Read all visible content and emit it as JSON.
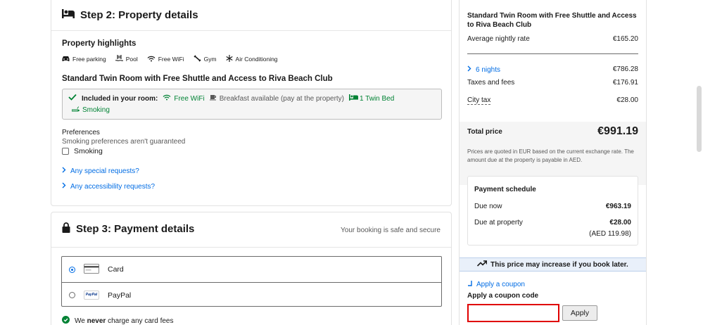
{
  "step2": {
    "title": "Step 2: Property details",
    "highlights_title": "Property highlights",
    "amenities": [
      "Free parking",
      "Pool",
      "Free WiFi",
      "Gym",
      "Air Conditioning"
    ],
    "room_title": "Standard Twin Room with Free Shuttle and Access to Riva Beach Club",
    "included": {
      "label": "Included in your room:",
      "wifi": "Free WiFi",
      "breakfast": "Breakfast available (pay at the property)",
      "bed": "1 Twin Bed",
      "smoking": "Smoking"
    },
    "preferences_title": "Preferences",
    "preferences_note": "Smoking preferences aren't guaranteed",
    "preference_option": "Smoking",
    "special_requests": "Any special requests?",
    "accessibility_requests": "Any accessibility requests?"
  },
  "step3": {
    "title": "Step 3: Payment details",
    "safe_note": "Your booking is safe and secure",
    "methods": [
      {
        "label": "Card",
        "selected": true
      },
      {
        "label": "PayPal",
        "selected": false
      }
    ],
    "paypal_logo": "PayPal",
    "fee_note_pre": "We ",
    "fee_note_bold": "never",
    "fee_note_post": " charge any card fees"
  },
  "summary": {
    "room_name": "Standard Twin Room with Free Shuttle and Access to Riva Beach Club",
    "avg_label": "Average nightly rate",
    "avg_value": "€165.20",
    "nights_label": "6 nights",
    "nights_value": "€786.28",
    "taxes_label": "Taxes and fees",
    "taxes_value": "€176.91",
    "city_tax_label": "City tax",
    "city_tax_value": "€28.00",
    "total_label": "Total price",
    "total_value": "€991.19",
    "note": "Prices are quoted in EUR based on the current exchange rate. The amount due at the property is payable in AED.",
    "schedule": {
      "title": "Payment schedule",
      "due_now_label": "Due now",
      "due_now_value": "€963.19",
      "due_property_label": "Due at property",
      "due_property_value": "€28.00",
      "due_property_aed": "(AED 119.98)"
    },
    "increase_note": "This price may increase if you book later.",
    "coupon_link": "Apply a coupon",
    "coupon_label": "Apply a coupon code",
    "coupon_value": "",
    "apply_label": "Apply"
  },
  "colors": {
    "link": "#006ce4",
    "green": "#008234",
    "coupon_border": "#e00000"
  }
}
